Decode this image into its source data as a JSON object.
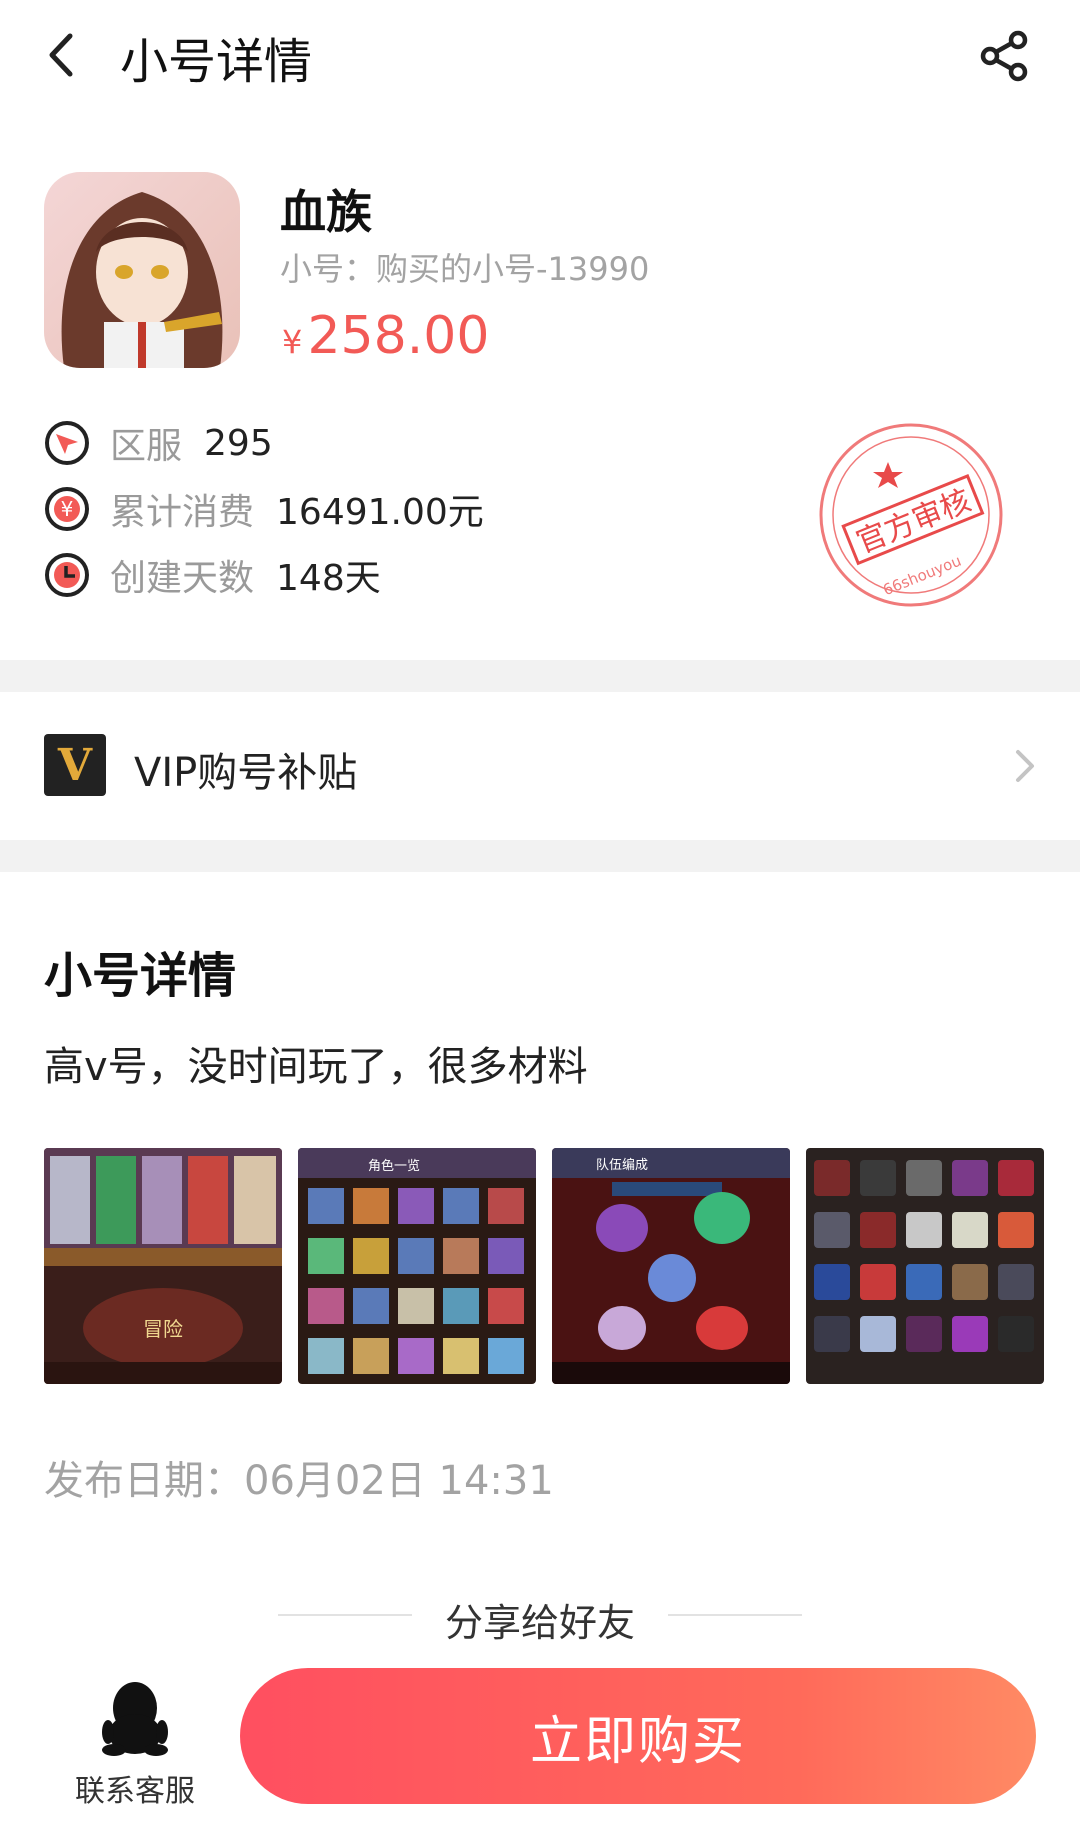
{
  "header": {
    "title": "小号详情"
  },
  "product": {
    "game_name": "血族",
    "account_id": "小号：购买的小号-13990",
    "currency": "¥",
    "price": "258.00"
  },
  "info": [
    {
      "label": "区服",
      "value": "295",
      "icon": "server-icon"
    },
    {
      "label": "累计消费",
      "value": "16491.00元",
      "icon": "yuan-icon"
    },
    {
      "label": "创建天数",
      "value": "148天",
      "icon": "clock-icon"
    }
  ],
  "stamp": {
    "text": "官方审核",
    "sub": "66shouyou"
  },
  "vip": {
    "badge": "V",
    "label": "VIP购号补贴"
  },
  "details": {
    "title": "小号详情",
    "description": "高v号，没时间玩了，很多材料",
    "publish_date": "发布日期：06月02日 14:31"
  },
  "screenshots": [
    {
      "name": "game-screenshot-1",
      "caption": "冒险"
    },
    {
      "name": "game-screenshot-2",
      "caption": "角色一览"
    },
    {
      "name": "game-screenshot-3",
      "caption": "队伍编成"
    },
    {
      "name": "game-screenshot-4",
      "caption": ""
    }
  ],
  "share": {
    "label": "分享给好友"
  },
  "bottom": {
    "service_label": "联系客服",
    "buy_label": "立即购买"
  },
  "colors": {
    "accent": "#f25a56",
    "buy_start": "#ff4f60",
    "buy_end": "#ff8a64",
    "muted": "#a3a3a3"
  }
}
